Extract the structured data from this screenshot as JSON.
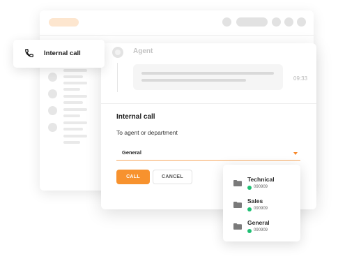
{
  "colors": {
    "accent": "#f7922e",
    "status_online": "#1fbf73"
  },
  "call_card": {
    "icon": "phone-icon",
    "label": "Internal call"
  },
  "conversation": {
    "agent_name": "Agent",
    "message_time": "09:33"
  },
  "form": {
    "title": "Internal call",
    "label": "To agent or department",
    "selected": "General",
    "call_button": "CALL",
    "cancel_button": "CANCEL"
  },
  "dropdown": {
    "items": [
      {
        "name": "Technical",
        "number": "090909",
        "icon": "folder-icon",
        "status": "online"
      },
      {
        "name": "Sales",
        "number": "090909",
        "icon": "folder-icon",
        "status": "online"
      },
      {
        "name": "General",
        "number": "090909",
        "icon": "folder-icon",
        "status": "online"
      }
    ]
  }
}
